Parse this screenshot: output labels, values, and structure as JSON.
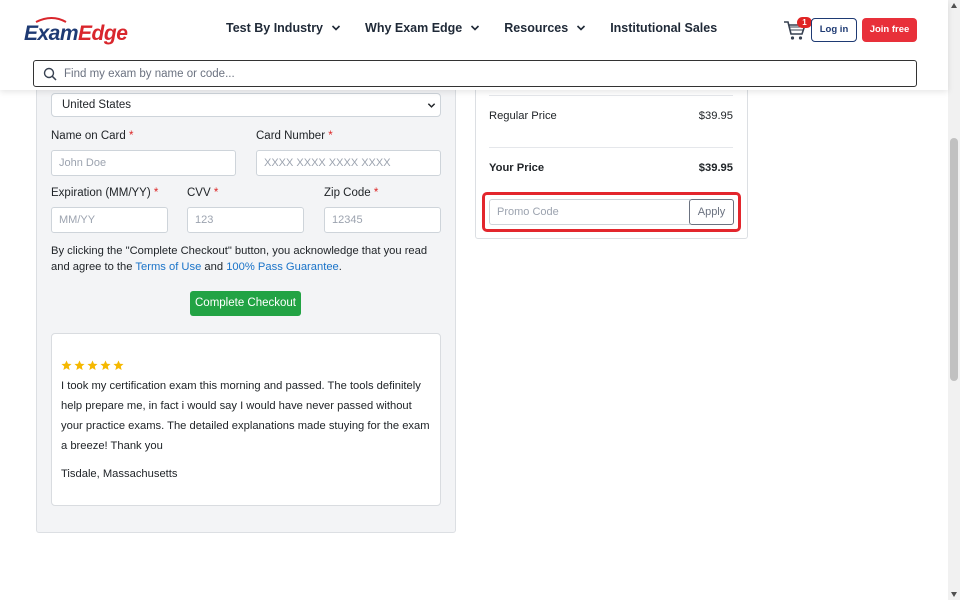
{
  "brand": {
    "logo_exam": "Exam",
    "logo_edge": "Edge"
  },
  "nav": {
    "items": [
      {
        "label": "Test By Industry",
        "has_dropdown": true
      },
      {
        "label": "Why Exam Edge",
        "has_dropdown": true
      },
      {
        "label": "Resources",
        "has_dropdown": true
      },
      {
        "label": "Institutional Sales",
        "has_dropdown": false
      }
    ],
    "cart_count": "1",
    "login_label": "Log in",
    "join_label": "Join free"
  },
  "search": {
    "placeholder": "Find my exam by name or code..."
  },
  "form": {
    "country_value": "United States",
    "name_on_card_label": "Name on Card",
    "name_on_card_placeholder": "John Doe",
    "card_number_label": "Card Number",
    "card_number_placeholder": "XXXX XXXX XXXX XXXX",
    "expiration_label": "Expiration (MM/YY)",
    "expiration_placeholder": "MM/YY",
    "cvv_label": "CVV",
    "cvv_placeholder": "123",
    "zip_label": "Zip Code",
    "zip_placeholder": "12345",
    "required_mark": "*",
    "ack_prefix": "By clicking the \"Complete Checkout\" button, you acknowledge that you read and agree to the ",
    "terms_link": "Terms of Use",
    "ack_and": " and ",
    "guarantee_link": "100% Pass Guarantee",
    "ack_suffix": ".",
    "checkout_label": "Complete Checkout"
  },
  "review": {
    "rating": 5,
    "text": "I took my certification exam this morning and passed. The tools definitely help prepare me, in fact i would say I would have never passed without your practice exams. The detailed explanations made stuying for the exam a breeze! Thank you",
    "author": "Tisdale, Massachusetts"
  },
  "summary": {
    "regular_price_label": "Regular Price",
    "regular_price_value": "$39.95",
    "your_price_label": "Your Price",
    "your_price_value": "$39.95",
    "promo_placeholder": "Promo Code",
    "apply_label": "Apply"
  },
  "colors": {
    "brand_navy": "#1e3a73",
    "brand_red": "#e8303a",
    "checkout_green": "#22a344",
    "link_blue": "#1a73c8",
    "star_gold": "#f5b800",
    "highlight_red": "#e3262d"
  }
}
